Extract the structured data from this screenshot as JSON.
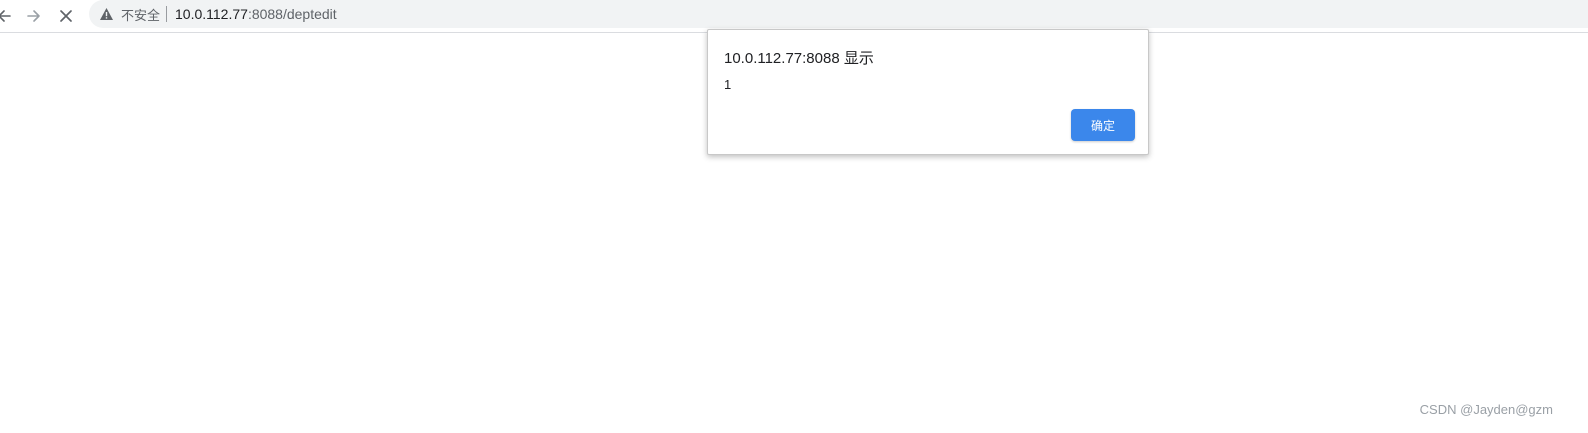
{
  "browser": {
    "security_label": "不安全",
    "url_host": "10.0.112.77",
    "url_path": ":8088/deptedit",
    "icons": {
      "back": "back-arrow-icon",
      "forward": "forward-arrow-icon",
      "stop": "close-icon",
      "warning": "warning-triangle-icon"
    }
  },
  "dialog": {
    "title": "10.0.112.77:8088 显示",
    "message": "1",
    "ok_label": "确定",
    "ok_color": "#3b87eb"
  },
  "watermark": {
    "text": "CSDN @Jayden@gzm"
  }
}
